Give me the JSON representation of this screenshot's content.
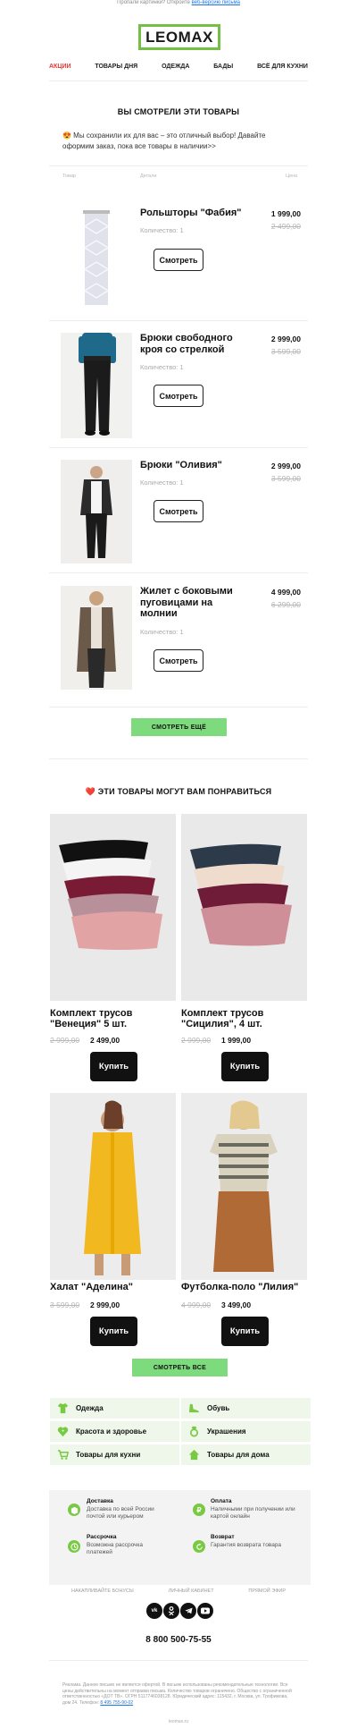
{
  "preheader": {
    "text": "Пропали картинки? Откройте ",
    "link": "веб-версию письма"
  },
  "logo": {
    "text": "LEOMAX",
    "border_color": "#74c044"
  },
  "nav": [
    "АКЦИИ",
    "ТОВАРЫ ДНЯ",
    "ОДЕЖДА",
    "БАДЫ",
    "ВСЁ ДЛЯ КУХНИ"
  ],
  "viewed": {
    "heading": "ВЫ СМОТРЕЛИ ЭТИ ТОВАРЫ",
    "intro": "😍 Мы сохранили их для вас – это отличный выбор! Давайте оформим заказ, пока все товары в наличии>>",
    "col_item": "Товар",
    "col_details": "Детали",
    "col_price": "Цена",
    "items": [
      {
        "title": "Рольшторы \"Фабия\"",
        "qty": "Количество: 1",
        "price": "1 999,00",
        "old": "2 499,00",
        "button": "Смотреть"
      },
      {
        "title": "Брюки свободного кроя со стрелкой",
        "qty": "Количество: 1",
        "price": "2 999,00",
        "old": "3 599,00",
        "button": "Смотреть"
      },
      {
        "title": "Брюки \"Оливия\"",
        "qty": "Количество: 1",
        "price": "2 999,00",
        "old": "3 599,00",
        "button": "Смотреть"
      },
      {
        "title": "Жилет с боковыми пуговицами на молнии",
        "qty": "Количество: 1",
        "price": "4 999,00",
        "old": "6 299,00",
        "button": "Смотреть"
      }
    ],
    "more_button": "СМОТРЕТЬ ЕЩЁ"
  },
  "recommend": {
    "heading": "❤️ ЭТИ ТОВАРЫ МОГУТ ВАМ ПОНРАВИТЬСЯ",
    "cards": [
      {
        "title": "Комплект трусов \"Венеция\" 5 шт.",
        "old": "2 999,00",
        "price": "2 499,00",
        "button": "Купить"
      },
      {
        "title": "Комплект трусов \"Сицилия\", 4 шт.",
        "old": "2 999,00",
        "price": "1 999,00",
        "button": "Купить"
      },
      {
        "title": "Халат \"Аделина\"",
        "old": "3 599,00",
        "price": "2 999,00",
        "button": "Купить"
      },
      {
        "title": "Футболка-поло \"Лилия\"",
        "old": "4 999,00",
        "price": "3 499,00",
        "button": "Купить"
      }
    ],
    "all_button": "СМОТРЕТЬ ВСЕ"
  },
  "categories": [
    {
      "label": "Одежда",
      "icon": "shirt-icon"
    },
    {
      "label": "Обувь",
      "icon": "shoe-icon"
    },
    {
      "label": "Красота и здоровье",
      "icon": "heart-plus-icon"
    },
    {
      "label": "Украшения",
      "icon": "ring-icon"
    },
    {
      "label": "Товары для кухни",
      "icon": "cart-icon"
    },
    {
      "label": "Товары для дома",
      "icon": "home-icon"
    }
  ],
  "info": [
    {
      "title": "Доставка",
      "text": "Доставка по всей России почтой или курьером",
      "icon": "box-icon"
    },
    {
      "title": "Оплата",
      "text": "Наличными при получении или картой онлайн",
      "icon": "ruble-icon"
    },
    {
      "title": "Рассрочка",
      "text": "Возможна рассрочка платежей",
      "icon": "clock-icon"
    },
    {
      "title": "Возврат",
      "text": "Гарантия возврата товара",
      "icon": "return-icon"
    }
  ],
  "footer_links": [
    "НАКАПЛИВАЙТЕ БОНУСЫ",
    "ЛИЧНЫЙ КАБИНЕТ",
    "ПРЯМОЙ ЭФИР"
  ],
  "socials": [
    "vk-icon",
    "ok-icon",
    "telegram-icon",
    "youtube-icon"
  ],
  "phone": "8 800 500-75-55",
  "legal": "Реклама. Данное письмо не является офертой. В письме использованы рекомендательные технологии. Все цены действительны на момент отправки письма. Количество товаров ограничено. Общество с ограниченной ответственностью «ДОТ ТВ». ОГРН 5117746038128. Юридический адрес: 115432, г. Москва, ул. Трофимова, дом 24. Телефон: ",
  "legal_phone": "8 495 755-90-02",
  "bottom_link": "leomax.ru"
}
